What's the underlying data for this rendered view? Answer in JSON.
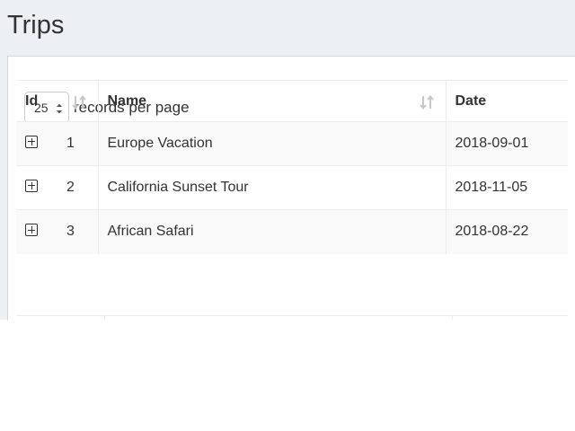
{
  "page": {
    "title": "Trips"
  },
  "length_control": {
    "value": "25",
    "label": "records per page"
  },
  "table": {
    "headers": {
      "id": "Id",
      "name": "Name",
      "date": "Date"
    },
    "rows": [
      {
        "id": "1",
        "name": "Europe Vacation",
        "date": "2018-09-01"
      },
      {
        "id": "2",
        "name": "California Sunset Tour",
        "date": "2018-11-05"
      },
      {
        "id": "3",
        "name": "African Safari",
        "date": "2018-08-22"
      }
    ]
  }
}
